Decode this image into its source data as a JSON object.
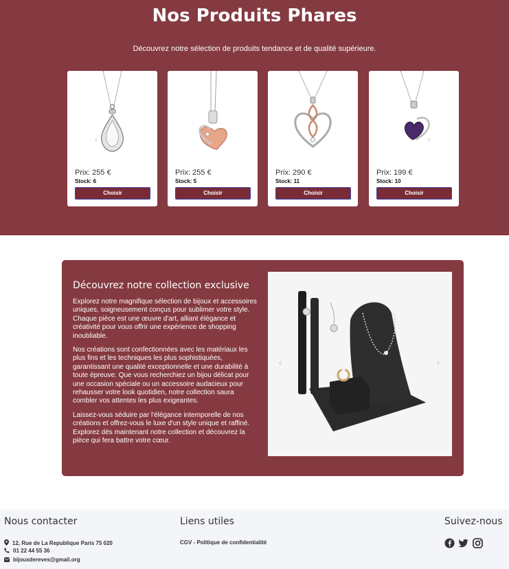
{
  "hero": {
    "title": "Nos Produits Phares",
    "subtitle": "Découvrez notre sélection de produits tendance et de qualité supérieure."
  },
  "products": [
    {
      "image": "silver-teardrop-pendant",
      "price": "Prix: 255 €",
      "stock": "Stock: 6",
      "button": "Choisir"
    },
    {
      "image": "rose-gold-heart-pendant",
      "price": "Prix: 255 €",
      "stock": "Stock: 5",
      "button": "Choisir"
    },
    {
      "image": "infinity-heart-pendant",
      "price": "Prix: 290 €",
      "stock": "Stock: 11",
      "button": "Choisir"
    },
    {
      "image": "purple-heart-pendant",
      "price": "Prix: 199 €",
      "stock": "Stock: 10",
      "button": "Choisir"
    }
  ],
  "collection": {
    "title": "Découvrez notre collection exclusive",
    "paragraphs": [
      "Explorez notre magnifique sélection de bijoux et accessoires uniques, soigneusement conçus pour sublimer votre style. Chaque pièce est une œuvre d'art, alliant élégance et créativité pour vous offrir une expérience de shopping inoubliable.",
      "Nos créations sont confectionnées avec les matériaux les plus fins et les techniques les plus sophistiquées, garantissant une qualité exceptionnelle et une durabilité à toute épreuve. Que vous recherchiez un bijou délicat pour une occasion spéciale ou un accessoire audacieux pour rehausser votre look quotidien, notre collection saura combler vos attentes les plus exigeantes.",
      "Laissez-vous séduire par l'élégance intemporelle de nos créations et offrez-vous le luxe d'un style unique et raffiné. Explorez dès maintenant notre collection et découvrez la pièce qui fera battre votre cœur."
    ],
    "image": "jewelry-display-stand"
  },
  "footer": {
    "contact_title": "Nous contacter",
    "address": "12, Rue de La Republique Paris 75 020",
    "phone": "01 22 44 55 36",
    "email": "bijouxdereves@gmail.org",
    "links_title": "Liens utiles",
    "links": [
      "CGV - Politique de confidentialité"
    ],
    "social_title": "Suivez-nous",
    "social_icons": [
      "facebook-icon",
      "twitter-icon",
      "instagram-icon"
    ]
  },
  "colors": {
    "brand": "#843a40",
    "button": "#7a2c36",
    "footer_bg": "#f3f5f8"
  }
}
